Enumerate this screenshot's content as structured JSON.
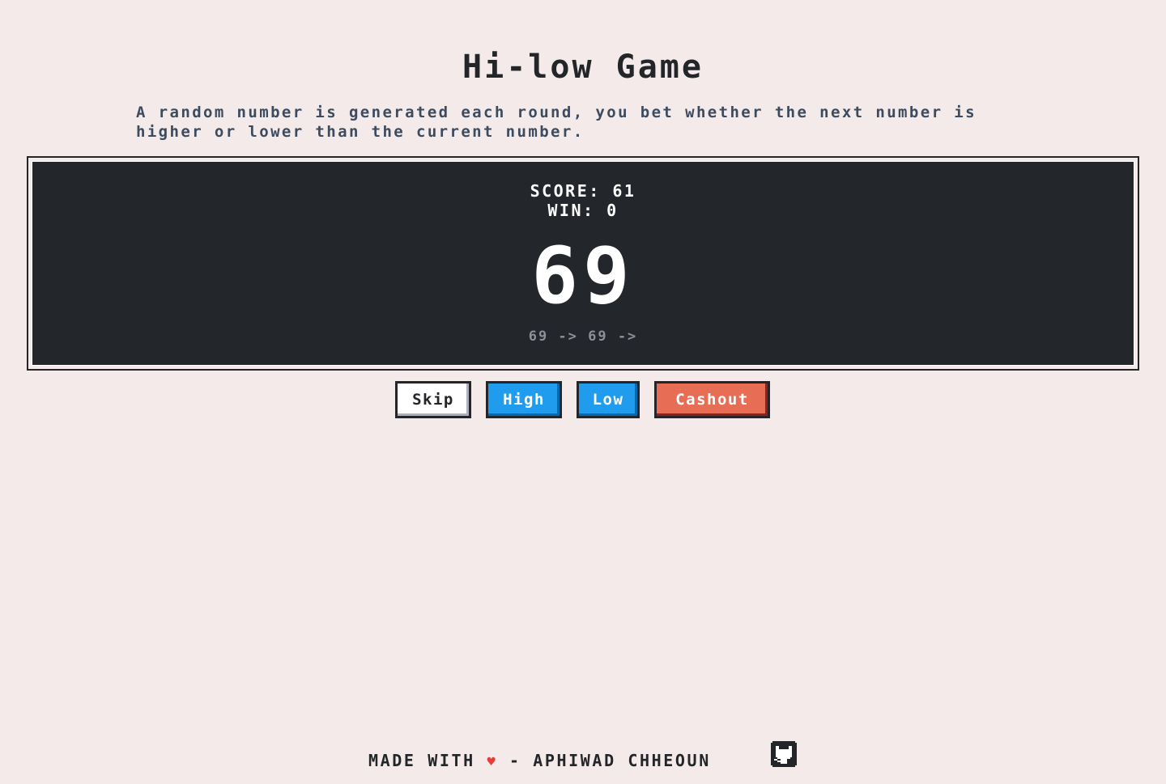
{
  "header": {
    "title": "Hi-low Game",
    "description": "A random number is generated each round, you bet whether the next number is higher or lower than the current number."
  },
  "board": {
    "score_label": "SCORE: 61",
    "win_label": "WIN: 0",
    "score": 61,
    "win": 0,
    "current_number": "69",
    "history": "69 -> 69 ->"
  },
  "actions": {
    "skip_label": "Skip",
    "high_label": "High",
    "low_label": "Low",
    "cashout_label": "Cashout"
  },
  "footer": {
    "made_with": "MADE WITH",
    "heart": "♥",
    "author": "- APHIWAD CHHEOUN",
    "github_icon": "github-icon"
  },
  "colors": {
    "background": "#f3eae9",
    "board": "#23262b",
    "primary_button": "#209cee",
    "error_button": "#e76e55",
    "heart": "#e33e3e"
  }
}
